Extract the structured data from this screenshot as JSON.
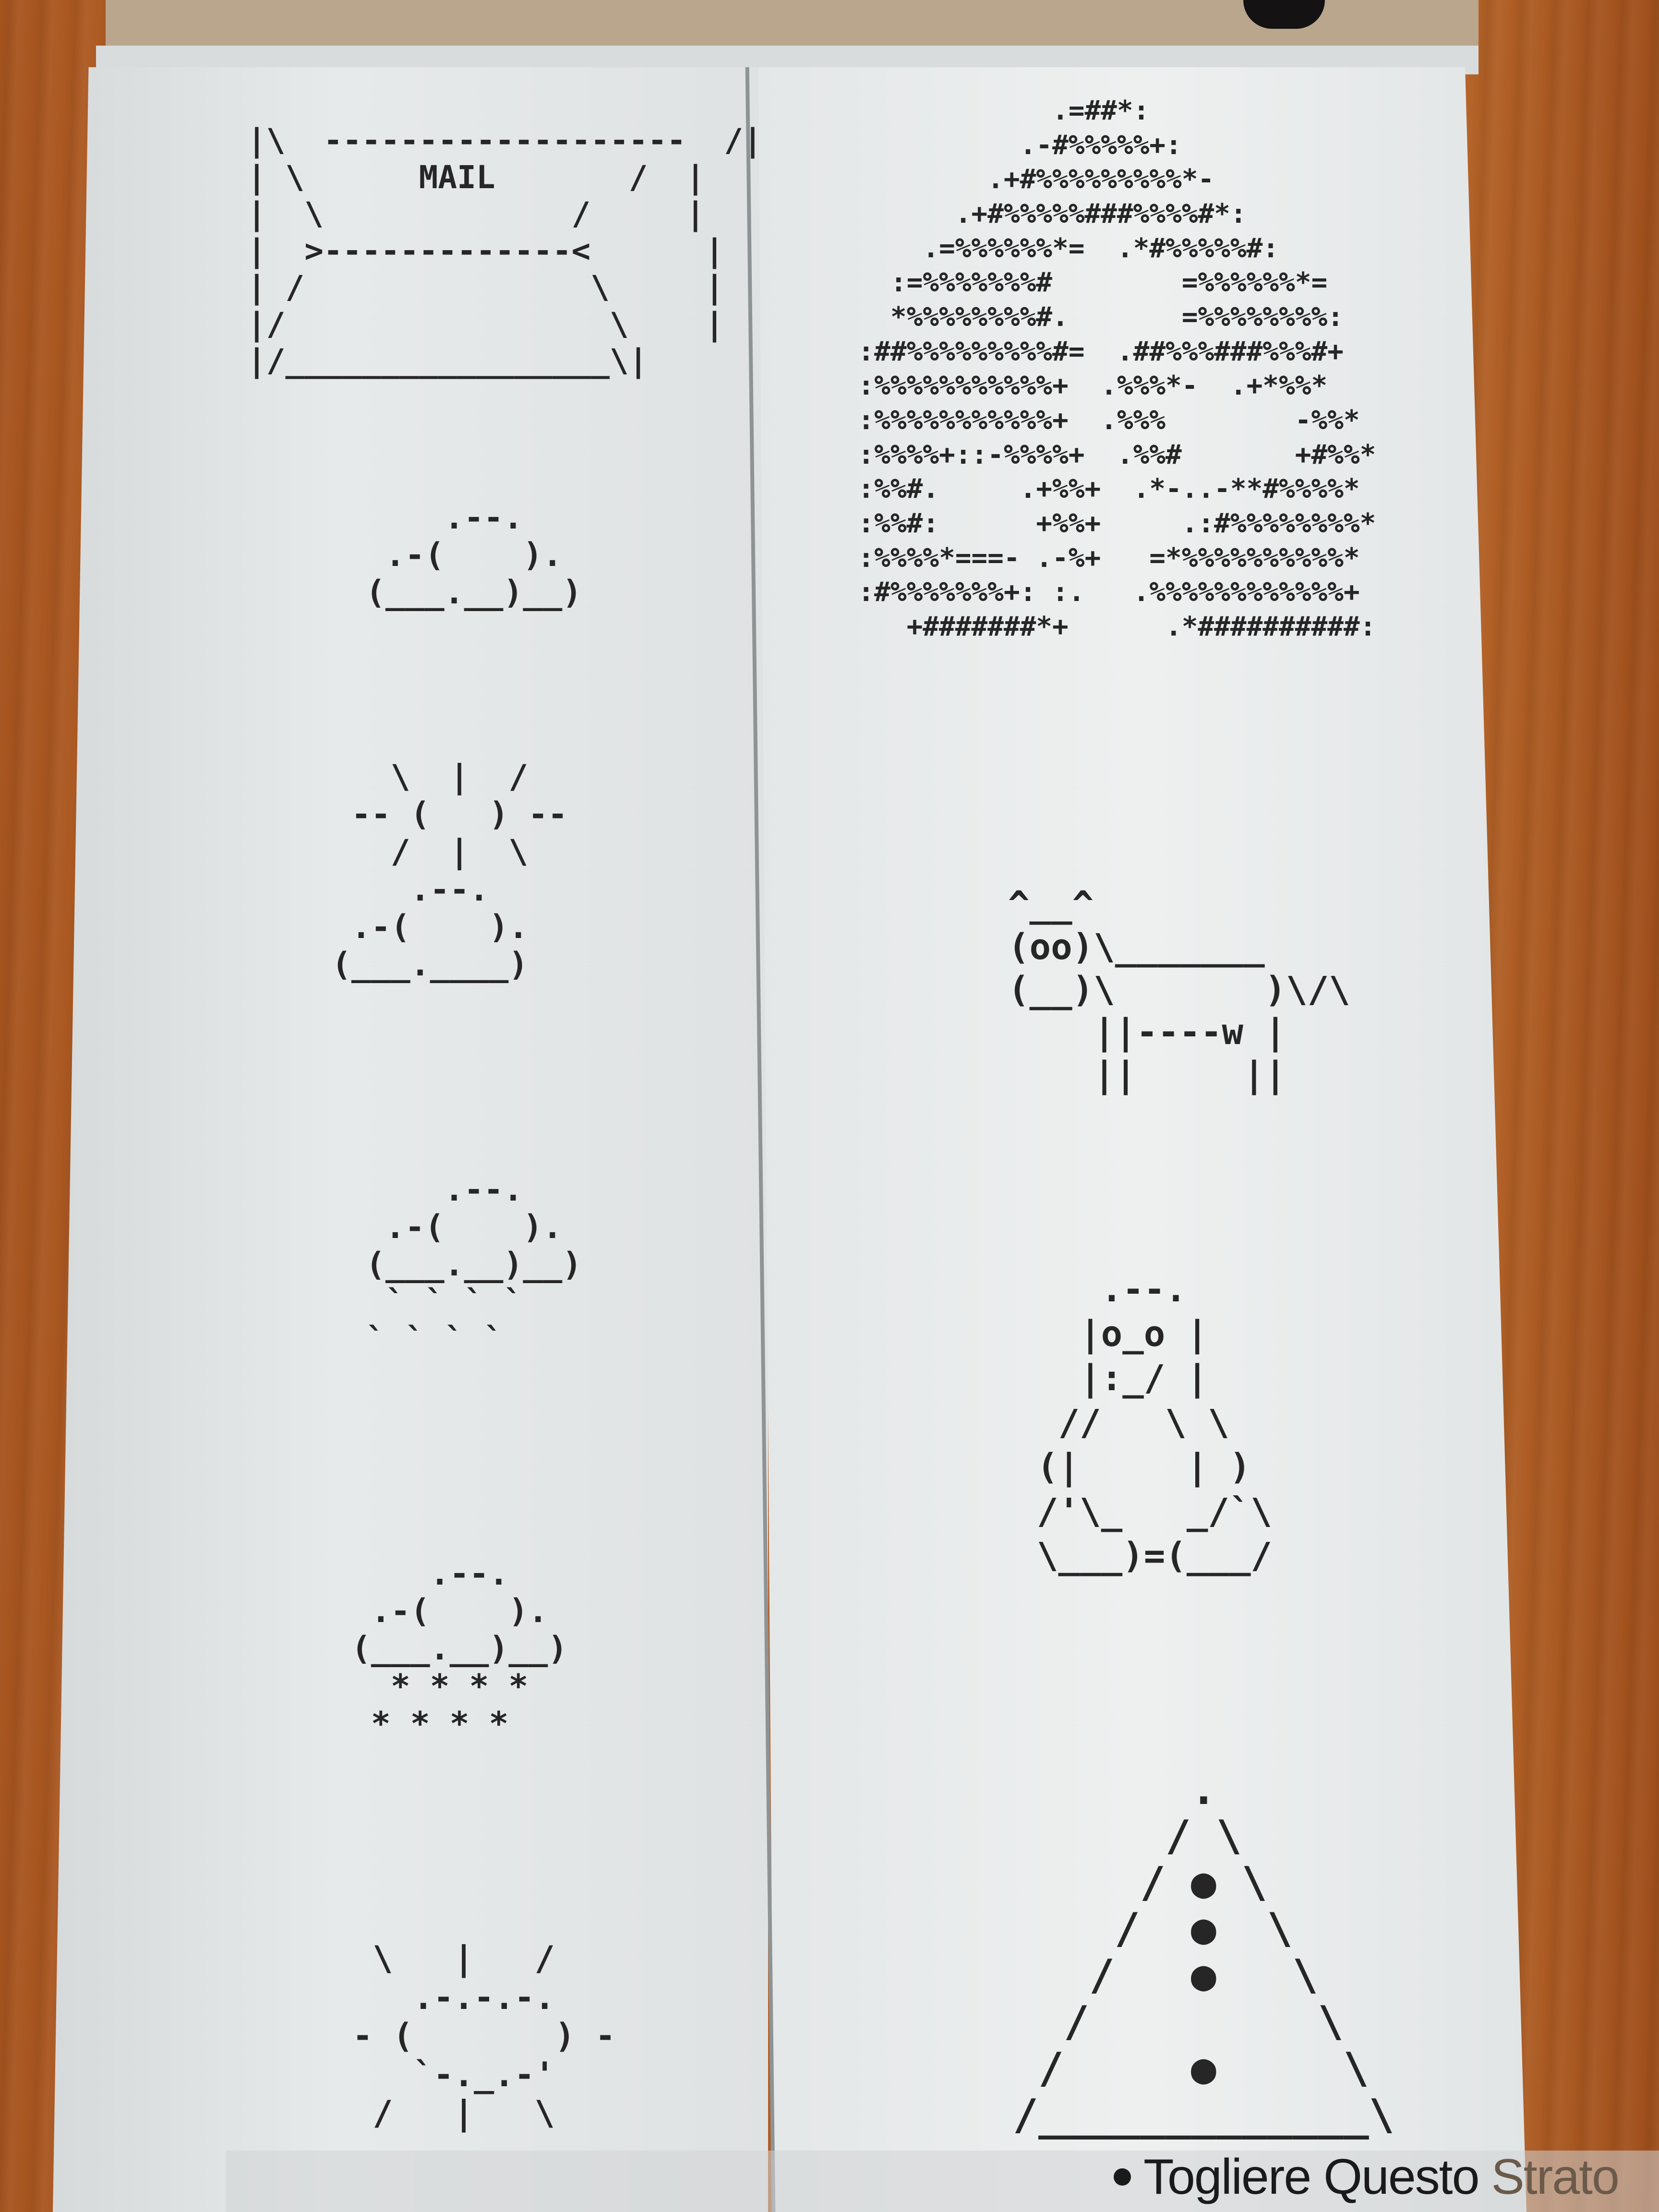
{
  "scene": {
    "description_colors": {
      "table": "#b5642a",
      "paper": "#e4e7e8",
      "ink": "#262626"
    }
  },
  "ascii_art": {
    "mail": "|\\  -------------------  /|\n| \\      MAIL       /  |\n|  \\             /     |\n|  >-------------<      |\n| /               \\     |\n|/                 \\    |\n|/_________________\\|",
    "cloud": "      .--.\n   .-(    ).\n  (___.__)__)",
    "sun_cloud": "    \\  |  /\n  -- (   ) --\n    /  |  \\\n     .--.\n  .-(    ).\n (___.____)",
    "rain": "      .--.\n   .-(    ).\n  (___.__)__)\n   ` ` ` `\n  ` ` ` `",
    "snow": "      .--.\n   .-(    ).\n  (___.__)__)\n    * * * *\n   * * * *",
    "sun": "   \\   |   /\n     .-.-.-.\n  - (       ) -\n     `-._.-'\n   /   |   \\",
    "globe": "              .=##*:\n            .-#%%%%%+:\n          .+#%%%%%%%%%*-\n        .+#%%%%%###%%%%#*:\n      .=%%%%%%*=  .*#%%%%%#:\n    :=%%%%%%%#        =%%%%%%*=\n    *%%%%%%%%#.       =%%%%%%%%:\n  :##%%%%%%%%%#=  .##%%%###%%%#+\n  :%%%%%%%%%%%+  .%%%*-  .+*%%*\n  :%%%%%%%%%%%+  .%%%        -%%*\n  :%%%%+::-%%%%+  .%%#       +#%%*\n  :%%#.     .+%%+  .*-..-**#%%%%*\n  :%%#:      +%%+     .:#%%%%%%%%*\n  :%%%%*===- .-%+   =*%%%%%%%%%%*\n  :#%%%%%%%+: :.   .%%%%%%%%%%%%+\n     +#######*+      .*##########:",
    "cow": "^__^\n(oo)\\_______\n(__)\\       )\\/\\\n    ||----w |\n    ||     ||",
    "tux": "   .--.\n  |o_o |\n  |:_/ |\n //   \\ \\\n(|     | )\n/'\\_   _/`\\\n\\___)=(___/",
    "triangle": "       .\n      / \\\n     / ● \\\n    /  ●  \\\n   /   ●   \\\n  /         \\\n /     ●     \\\n/_____________\\"
  },
  "caption": {
    "text": "Togliere Questo",
    "trailing": "Strato"
  }
}
